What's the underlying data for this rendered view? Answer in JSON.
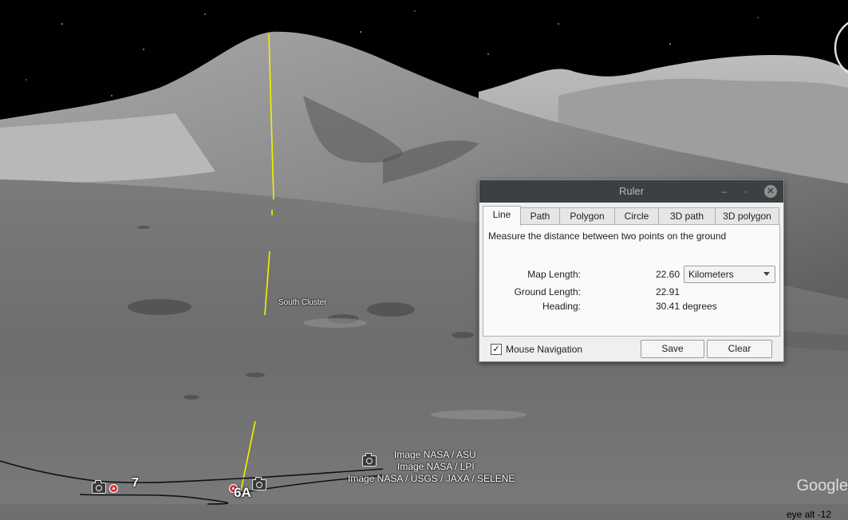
{
  "scene": {
    "poi_label": "South Cluster",
    "markers": [
      "7",
      "6A"
    ],
    "attribution": [
      "Image NASA / ASU",
      "Image NASA / LPI",
      "Image NASA / USGS / JAXA / SELENE"
    ],
    "logo": "Google",
    "eye_alt": "eye alt  -12"
  },
  "ruler": {
    "title": "Ruler",
    "window_controls": {
      "minimize": "–",
      "maximize": "▫",
      "close": "✕"
    },
    "tabs": [
      {
        "label": "Line",
        "active": true
      },
      {
        "label": "Path"
      },
      {
        "label": "Polygon"
      },
      {
        "label": "Circle"
      },
      {
        "label": "3D path"
      },
      {
        "label": "3D polygon"
      }
    ],
    "description": "Measure the distance between two points on the ground",
    "map_length": {
      "label": "Map Length:",
      "value": "22.60"
    },
    "units": {
      "selected": "Kilometers"
    },
    "ground_length": {
      "label": "Ground Length:",
      "value": "22.91"
    },
    "heading": {
      "label": "Heading:",
      "value": "30.41 degrees"
    },
    "mouse_navigation": {
      "label": "Mouse Navigation",
      "checked": true,
      "mark": "✓"
    },
    "save_label": "Save",
    "clear_label": "Clear"
  }
}
